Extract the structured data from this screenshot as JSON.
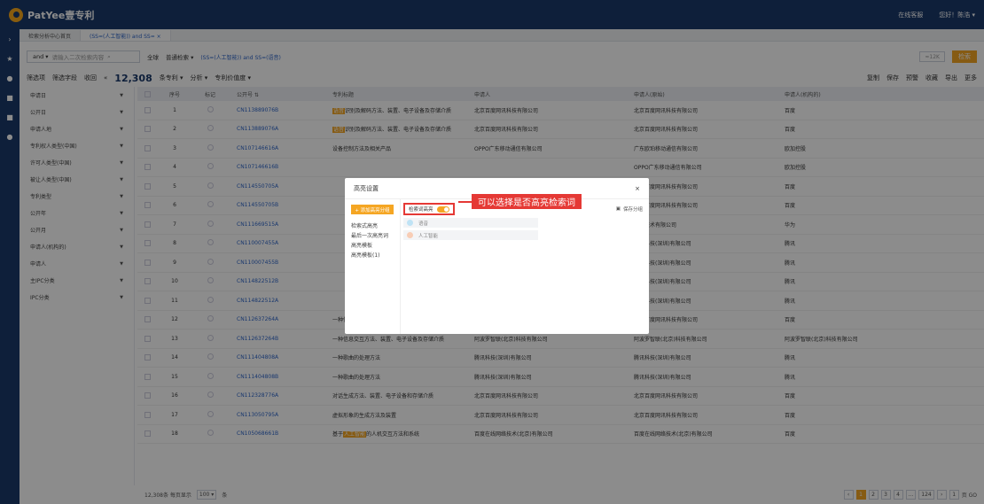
{
  "app": {
    "brand": "PatYee壹专利",
    "service": "在线客服",
    "greeting": "您好！陈浩 ▾"
  },
  "tabs": [
    {
      "label": "检索分析中心首页"
    },
    {
      "label": "(SS=(人工智能)) and SS= ×"
    }
  ],
  "search": {
    "logic": "and ▾",
    "placeholder": "请输入二次检索内容",
    "scope": "全球",
    "mode": "普通检索 ▾",
    "expression": "(SS=(人工智能)) and SS=(语音)",
    "limit": "≈12K",
    "button": "检索"
  },
  "filters": {
    "filter_label": "筛选项",
    "field_label": "筛选字段",
    "collapse_label": "收回",
    "count_prefix": "«",
    "count": "12,308",
    "count_unit": "条专利 ▾",
    "analysis": "分析 ▾",
    "value_label": "专利价值度 ▾",
    "actions": [
      "复制",
      "保存",
      "预警",
      "收藏",
      "导出",
      "更多"
    ]
  },
  "left_panel": [
    {
      "label": "申请日"
    },
    {
      "label": "公开日"
    },
    {
      "label": "申请人地"
    },
    {
      "label": "专利权人类型(中国)"
    },
    {
      "label": "许可人类型(中国)"
    },
    {
      "label": "被让人类型(中国)"
    },
    {
      "label": "专利类型"
    },
    {
      "label": "公开年"
    },
    {
      "label": "公开月"
    },
    {
      "label": "申请人(机构的)"
    },
    {
      "label": "申请人"
    },
    {
      "label": "主IPC分类"
    },
    {
      "label": "IPC分类"
    }
  ],
  "table": {
    "headers": [
      "序号",
      "标记",
      "公开号 ⇅",
      "专利标题",
      "申请人",
      "申请人(原始)",
      "申请人(机构的)"
    ],
    "rows": [
      {
        "n": "1",
        "pn": "CN113889076B",
        "title": "语音识别及解码方法、装置、电子设备及存储介质",
        "ap": "北京百度网讯科技有限公司",
        "apo": "北京百度网讯科技有限公司",
        "org": "百度"
      },
      {
        "n": "2",
        "pn": "CN113889076A",
        "title": "语音识别及解码方法、装置、电子设备及存储介质",
        "ap": "北京百度网讯科技有限公司",
        "apo": "北京百度网讯科技有限公司",
        "org": "百度"
      },
      {
        "n": "3",
        "pn": "CN107146616A",
        "title": "设备控制方法及相关产品",
        "ap": "OPPO广东移动通信有限公司",
        "apo": "广东欧珀移动通信有限公司",
        "org": "欧加控股"
      },
      {
        "n": "4",
        "pn": "CN107146616B",
        "title": "",
        "ap": "",
        "apo": "OPPO广东移动通信有限公司",
        "org": "欧加控股"
      },
      {
        "n": "5",
        "pn": "CN114550705A",
        "title": "",
        "ap": "",
        "apo": "北京百度网讯科技有限公司",
        "org": "百度"
      },
      {
        "n": "6",
        "pn": "CN114550705B",
        "title": "",
        "ap": "",
        "apo": "北京百度网讯科技有限公司",
        "org": "百度"
      },
      {
        "n": "7",
        "pn": "CN111669515A",
        "title": "",
        "ap": "",
        "apo": "华为技术有限公司",
        "org": "华为"
      },
      {
        "n": "8",
        "pn": "CN110007455A",
        "title": "",
        "ap": "",
        "apo": "腾讯科技(深圳)有限公司",
        "org": "腾讯"
      },
      {
        "n": "9",
        "pn": "CN110007455B",
        "title": "",
        "ap": "",
        "apo": "腾讯科技(深圳)有限公司",
        "org": "腾讯"
      },
      {
        "n": "10",
        "pn": "CN114822512B",
        "title": "",
        "ap": "",
        "apo": "腾讯科技(深圳)有限公司",
        "org": "腾讯"
      },
      {
        "n": "11",
        "pn": "CN114822512A",
        "title": "",
        "ap": "",
        "apo": "腾讯科技(深圳)有限公司",
        "org": "腾讯"
      },
      {
        "n": "12",
        "pn": "CN112637264A",
        "title": "一种信息交互方法、装置、电子设备及存储介质",
        "ap": "北京百度网讯科技有限公司",
        "apo": "北京百度网讯科技有限公司",
        "org": "百度"
      },
      {
        "n": "13",
        "pn": "CN112637264B",
        "title": "一种信息交互方法、装置、电子设备及存储介质",
        "ap": "阿波罗智联(北京)科技有限公司",
        "apo": "阿波罗智联(北京)科技有限公司",
        "org": "阿波罗智联(北京)科技有限公司"
      },
      {
        "n": "14",
        "pn": "CN111404808A",
        "title": "一种歌曲的处理方法",
        "ap": "腾讯科技(深圳)有限公司",
        "apo": "腾讯科技(深圳)有限公司",
        "org": "腾讯"
      },
      {
        "n": "15",
        "pn": "CN111404808B",
        "title": "一种歌曲的处理方法",
        "ap": "腾讯科技(深圳)有限公司",
        "apo": "腾讯科技(深圳)有限公司",
        "org": "腾讯"
      },
      {
        "n": "16",
        "pn": "CN112328776A",
        "title": "对话生成方法、装置、电子设备和存储介质",
        "ap": "北京百度网讯科技有限公司",
        "apo": "北京百度网讯科技有限公司",
        "org": "百度"
      },
      {
        "n": "17",
        "pn": "CN113050795A",
        "title": "虚拟形象的生成方法及装置",
        "ap": "北京百度网讯科技有限公司",
        "apo": "北京百度网讯科技有限公司",
        "org": "百度"
      },
      {
        "n": "18",
        "pn": "CN105068661B",
        "title": "基于人工智能的人机交互方法和系统",
        "ap": "百度在线网络技术(北京)有限公司",
        "apo": "百度在线网络技术(北京)有限公司",
        "org": "百度"
      }
    ]
  },
  "footer": {
    "total": "12,308条 每页显示",
    "per_page": "100 ▾",
    "unit": "条",
    "pages": [
      "1",
      "2",
      "3",
      "4",
      "...",
      "124"
    ],
    "goto": "1",
    "goto_suffix": "页 GO"
  },
  "modal": {
    "title": "高亮设置",
    "add_button": "+ 添加高亮分组",
    "side_items": [
      "检索式高亮",
      "最后一次高亮词",
      "高亮模板",
      "高亮模板(1)"
    ],
    "toggle_label": "检索词高亮",
    "save_template": "保存分组",
    "terms": [
      "语音",
      "人工智能"
    ]
  },
  "callout": "可以选择是否高亮检索词",
  "colors": {
    "nav": "#1b3a6b",
    "accent": "#f5a623",
    "callout": "#e53935"
  }
}
